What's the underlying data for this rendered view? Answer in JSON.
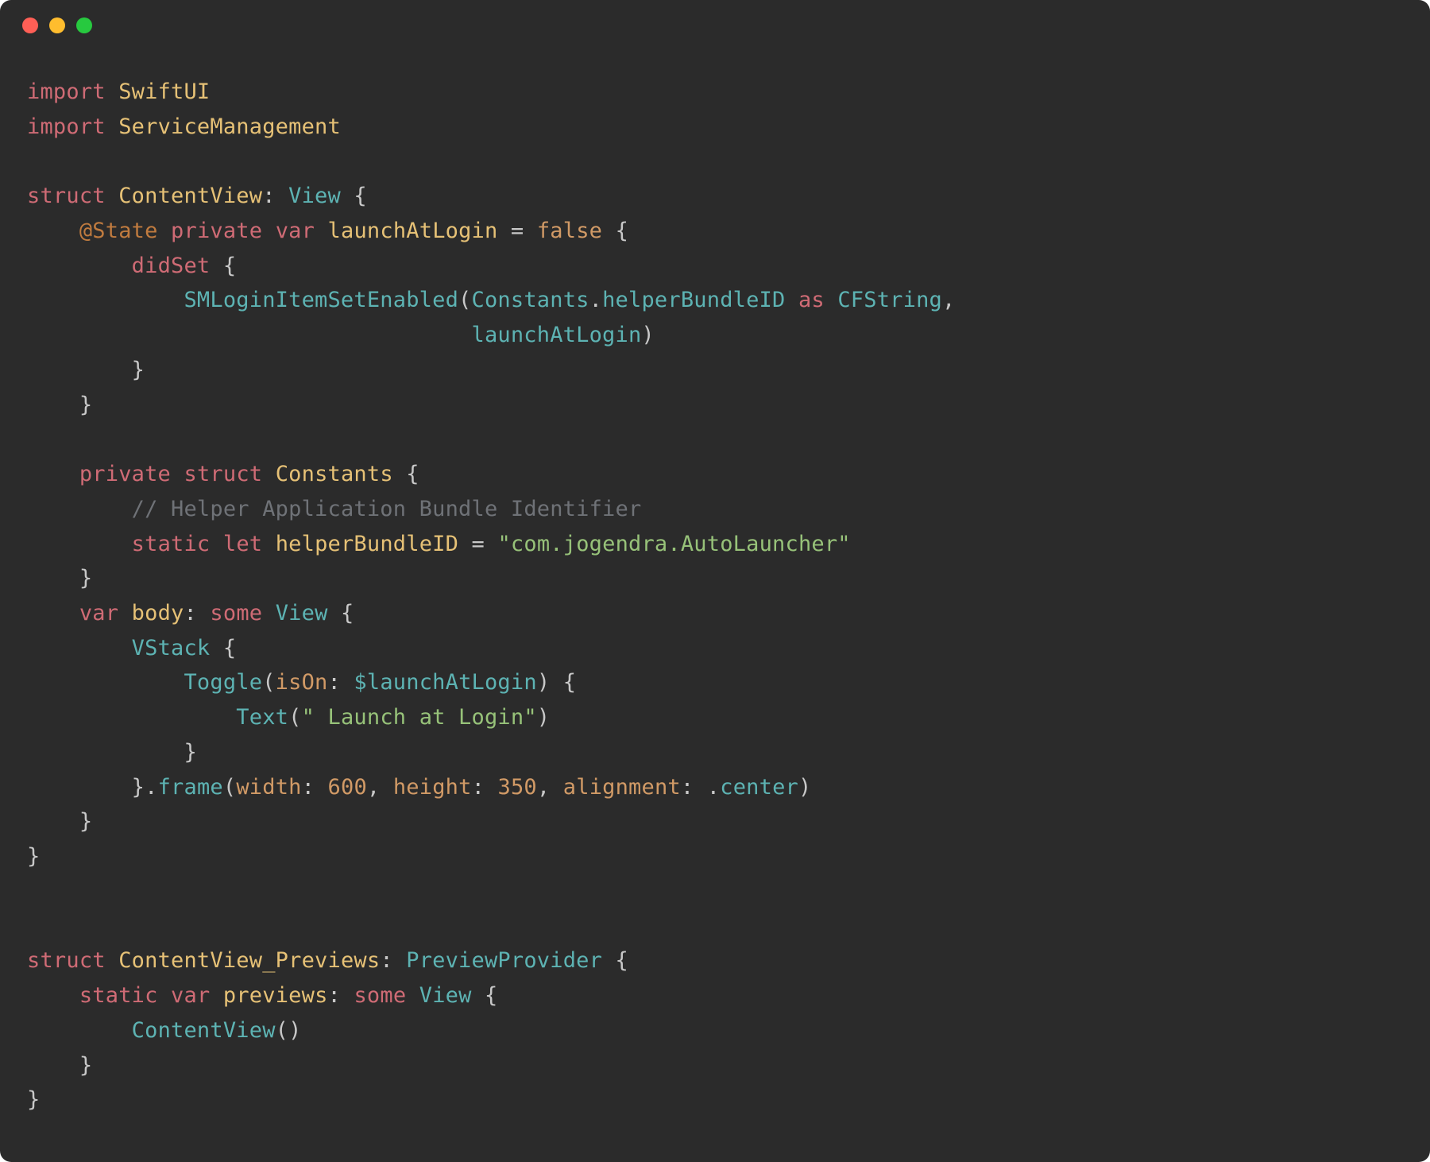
{
  "code": {
    "l1": {
      "kw1": "import",
      "id1": "SwiftUI"
    },
    "l2": {
      "kw1": "import",
      "id1": "ServiceManagement"
    },
    "l4": {
      "kw1": "struct",
      "name": "ContentView",
      "type": "View"
    },
    "l5": {
      "attr": "@State",
      "kw1": "private",
      "kw2": "var",
      "name": "launchAtLogin",
      "val": "false"
    },
    "l6": {
      "kw": "didSet"
    },
    "l7": {
      "fn": "SMLoginItemSetEnabled",
      "ns": "Constants",
      "prop": "helperBundleID",
      "kw_as": "as",
      "type": "CFString"
    },
    "l8": {
      "arg": "launchAtLogin"
    },
    "l12": {
      "kw1": "private",
      "kw2": "struct",
      "name": "Constants"
    },
    "l13": {
      "comment": "// Helper Application Bundle Identifier"
    },
    "l14": {
      "kw1": "static",
      "kw2": "let",
      "name": "helperBundleID",
      "val": "\"com.jogendra.AutoLauncher\""
    },
    "l16": {
      "kw1": "var",
      "name": "body",
      "kw2": "some",
      "type": "View"
    },
    "l17": {
      "fn": "VStack"
    },
    "l18": {
      "fn": "Toggle",
      "p1": "isOn",
      "arg": "$launchAtLogin"
    },
    "l19": {
      "fn": "Text",
      "str": "\" Launch at Login\""
    },
    "l21": {
      "fn": "frame",
      "p1": "width",
      "v1": "600",
      "p2": "height",
      "v2": "350",
      "p3": "alignment",
      "v3": "center"
    },
    "l26": {
      "kw1": "struct",
      "name": "ContentView_Previews",
      "type": "PreviewProvider"
    },
    "l27": {
      "kw1": "static",
      "kw2": "var",
      "name": "previews",
      "kw3": "some",
      "type": "View"
    },
    "l28": {
      "fn": "ContentView"
    }
  }
}
